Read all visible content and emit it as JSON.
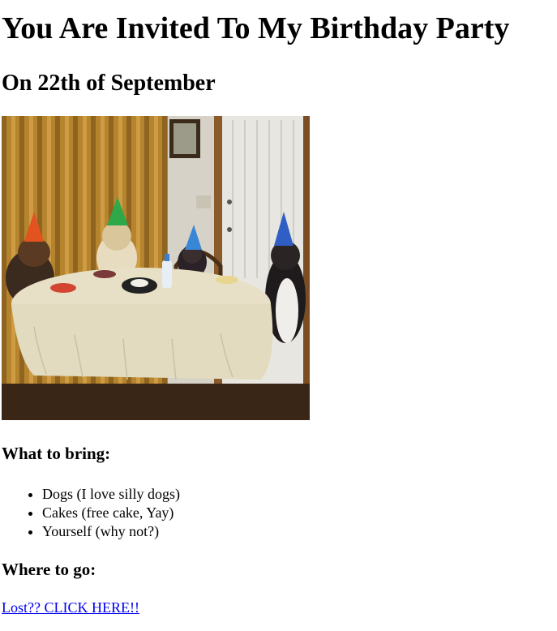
{
  "heading": "You Are Invited To My Birthday Party",
  "subheading": "On 22th of September",
  "image_alt": "Dogs wearing party hats around a table",
  "bring": {
    "title": "What to bring:",
    "items": [
      "Dogs (I love silly dogs)",
      "Cakes (free cake, Yay)",
      "Yourself (why not?)"
    ]
  },
  "where": {
    "title": "Where to go:",
    "link_text": "Lost?? CLICK HERE!!"
  },
  "colors": {
    "link": "#0000ee",
    "text": "#000000",
    "background": "#ffffff"
  }
}
